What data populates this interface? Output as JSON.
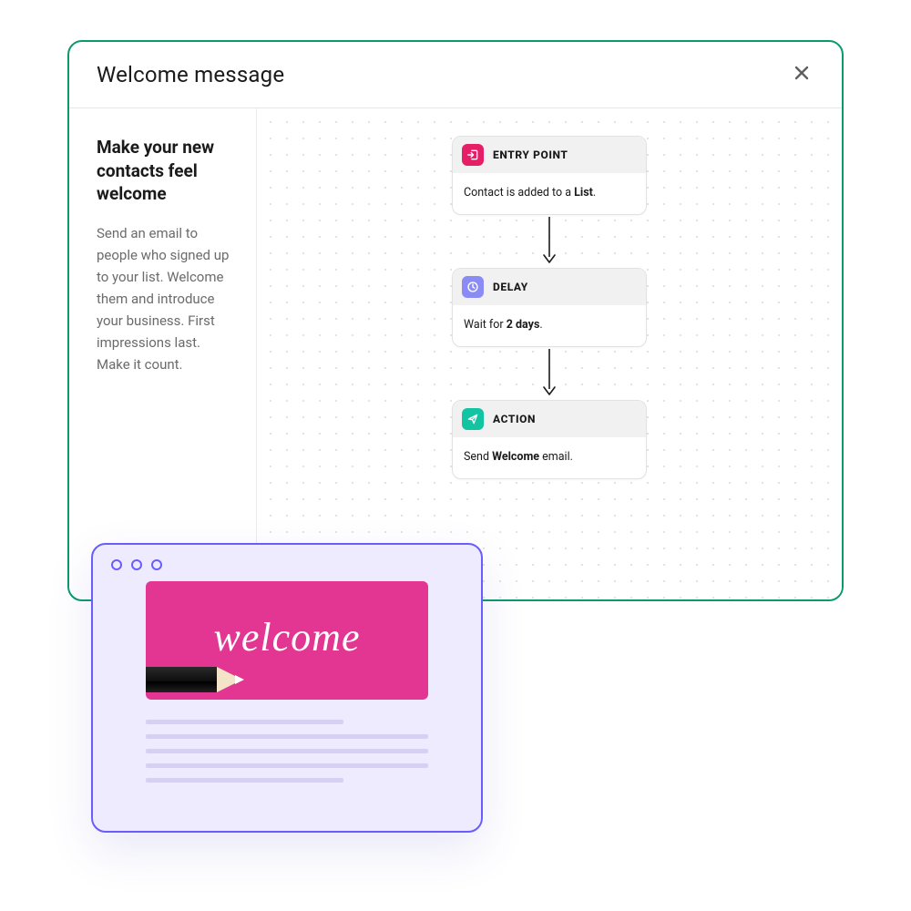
{
  "modal": {
    "title": "Welcome message",
    "close_label": "Close"
  },
  "sidebar": {
    "heading": "Make your new contacts feel welcome",
    "description": "Send an email to people who signed up to your list. Welcome them and introduce your business. First impressions last. Make it count."
  },
  "flow": {
    "entry": {
      "title": "ENTRY POINT",
      "desc_prefix": "Contact is added to a ",
      "desc_bold": "List",
      "desc_suffix": "."
    },
    "delay": {
      "title": "DELAY",
      "desc_prefix": "Wait for ",
      "desc_bold": "2 days",
      "desc_suffix": "."
    },
    "action": {
      "title": "ACTION",
      "desc_prefix": "Send ",
      "desc_bold": "Welcome",
      "desc_suffix": " email."
    }
  },
  "preview": {
    "image_text": "welcome"
  },
  "colors": {
    "accent_border": "#0b996e",
    "entry_icon": "#e61e66",
    "delay_icon": "#8b8bf5",
    "action_icon": "#13c4a3",
    "preview_border": "#6a5cff",
    "preview_bg": "#eeebff",
    "welcome_bg": "#e33693"
  }
}
